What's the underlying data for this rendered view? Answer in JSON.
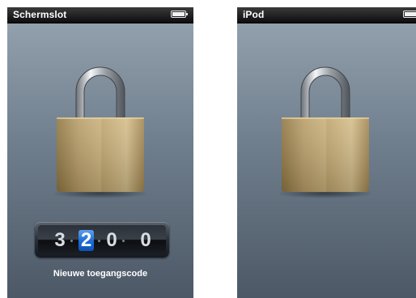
{
  "left_screen": {
    "status_title": "Schermslot",
    "passcode_digits": [
      "3",
      "2",
      "0",
      "0"
    ],
    "active_digit_index": 1,
    "caption": "Nieuwe toegangscode"
  },
  "right_screen": {
    "status_title": "iPod"
  },
  "icons": [
    "battery-icon",
    "padlock-icon"
  ],
  "colors": {
    "status_bar": "#111111",
    "screen_top": "#97a4b1",
    "screen_bottom": "#4c5866",
    "lock_body": "#b99e6a",
    "active_digit": "#1f6fd6"
  }
}
